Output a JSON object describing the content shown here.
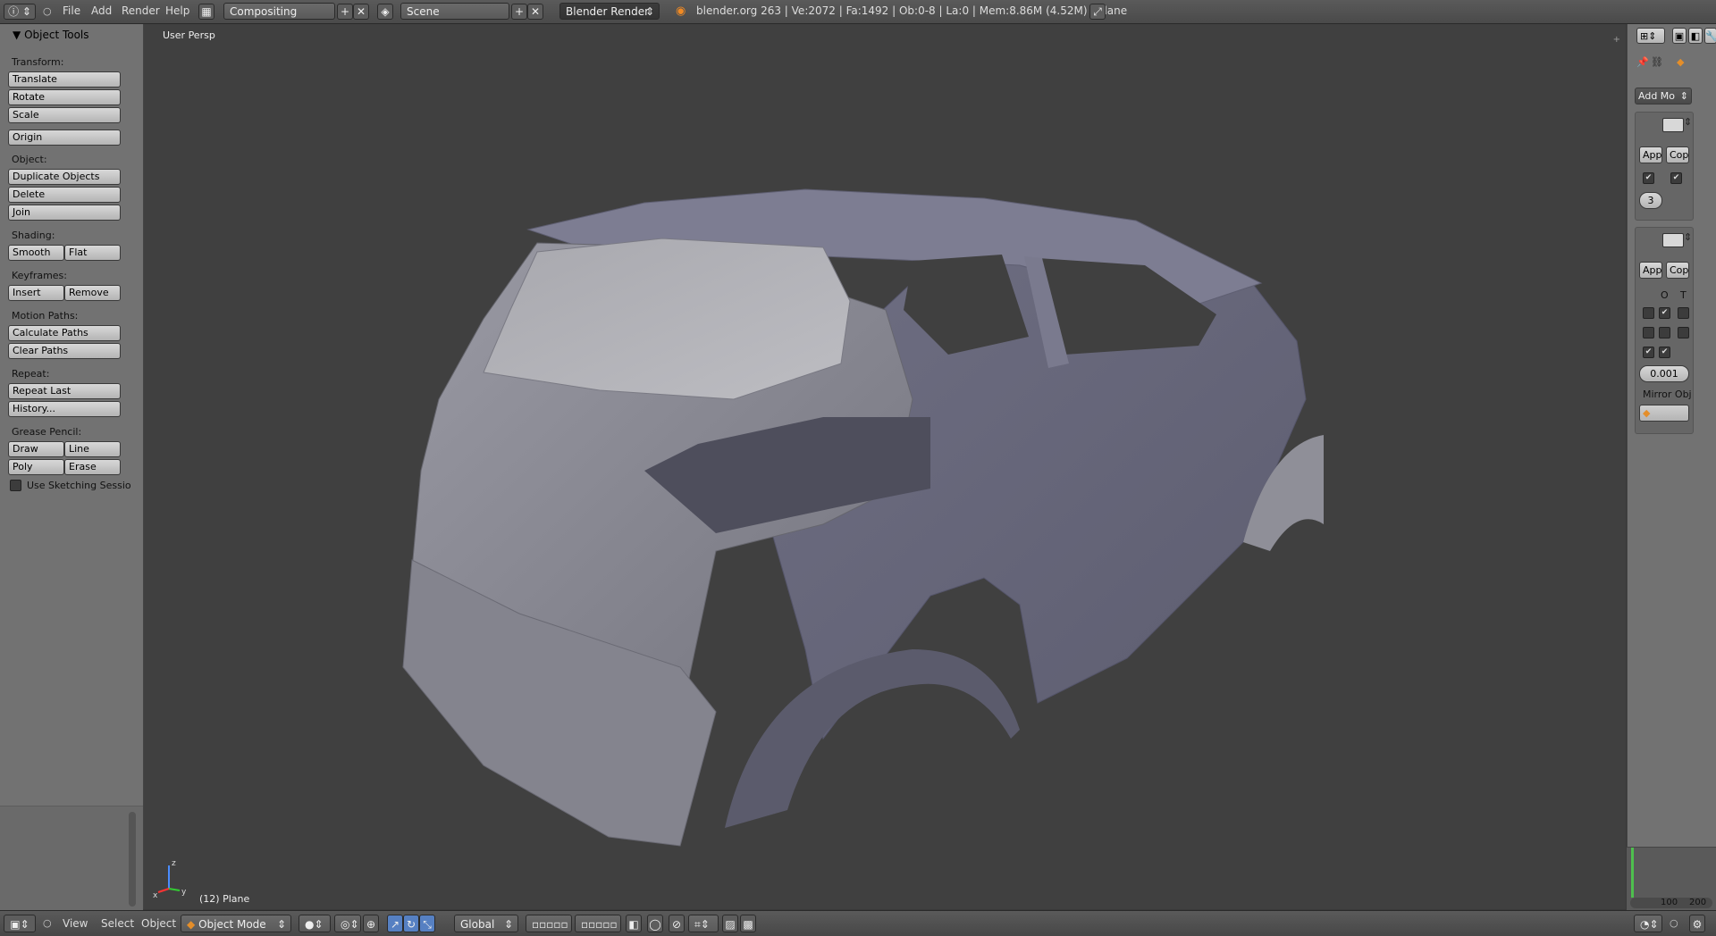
{
  "topbar": {
    "info_icon": "info-icon",
    "menu": [
      "File",
      "Add",
      "Render",
      "Help"
    ],
    "screen_layout": "Compositing",
    "scene": "Scene",
    "render_engine": "Blender Render",
    "stats": "blender.org 263 | Ve:2072 | Fa:1492 | Ob:0-8 | La:0 | Mem:8.86M (4.52M) | Plane"
  },
  "toolshelf": {
    "header": "Object Tools",
    "sections": {
      "transform": "Transform:",
      "translate": "Translate",
      "rotate": "Rotate",
      "scale": "Scale",
      "origin": "Origin",
      "object": "Object:",
      "duplicate": "Duplicate Objects",
      "delete": "Delete",
      "join": "Join",
      "shading": "Shading:",
      "smooth": "Smooth",
      "flat": "Flat",
      "keyframes": "Keyframes:",
      "insert": "Insert",
      "remove": "Remove",
      "motion_paths": "Motion Paths:",
      "calculate_paths": "Calculate Paths",
      "clear_paths": "Clear Paths",
      "repeat": "Repeat:",
      "repeat_last": "Repeat Last",
      "history": "History...",
      "grease_pencil": "Grease Pencil:",
      "draw": "Draw",
      "line": "Line",
      "poly": "Poly",
      "erase": "Erase",
      "use_sketching": "Use Sketching Sessio"
    }
  },
  "viewport": {
    "title": "User Persp",
    "object_label": "(12) Plane",
    "axis_labels": {
      "x": "x",
      "y": "y",
      "z": "z"
    }
  },
  "properties": {
    "add_modifier": "Add Mo",
    "apply_1": "Appl",
    "copy_1": "Cop",
    "levels": "3",
    "apply_2": "Appl",
    "copy_2": "Cop",
    "col_o": "O",
    "col_t": "T",
    "merge_limit": "0.001",
    "mirror_object": "Mirror Obj"
  },
  "timeline": {
    "tick_100": "100",
    "tick_200": "200"
  },
  "bottombar": {
    "menu": [
      "View",
      "Select",
      "Object"
    ],
    "mode": "Object Mode",
    "orientation": "Global"
  },
  "colors": {
    "viewport_bg": "#404040",
    "panel_bg": "#727272",
    "car_body": "#8a8a9c",
    "active_blue": "#5680c2"
  }
}
